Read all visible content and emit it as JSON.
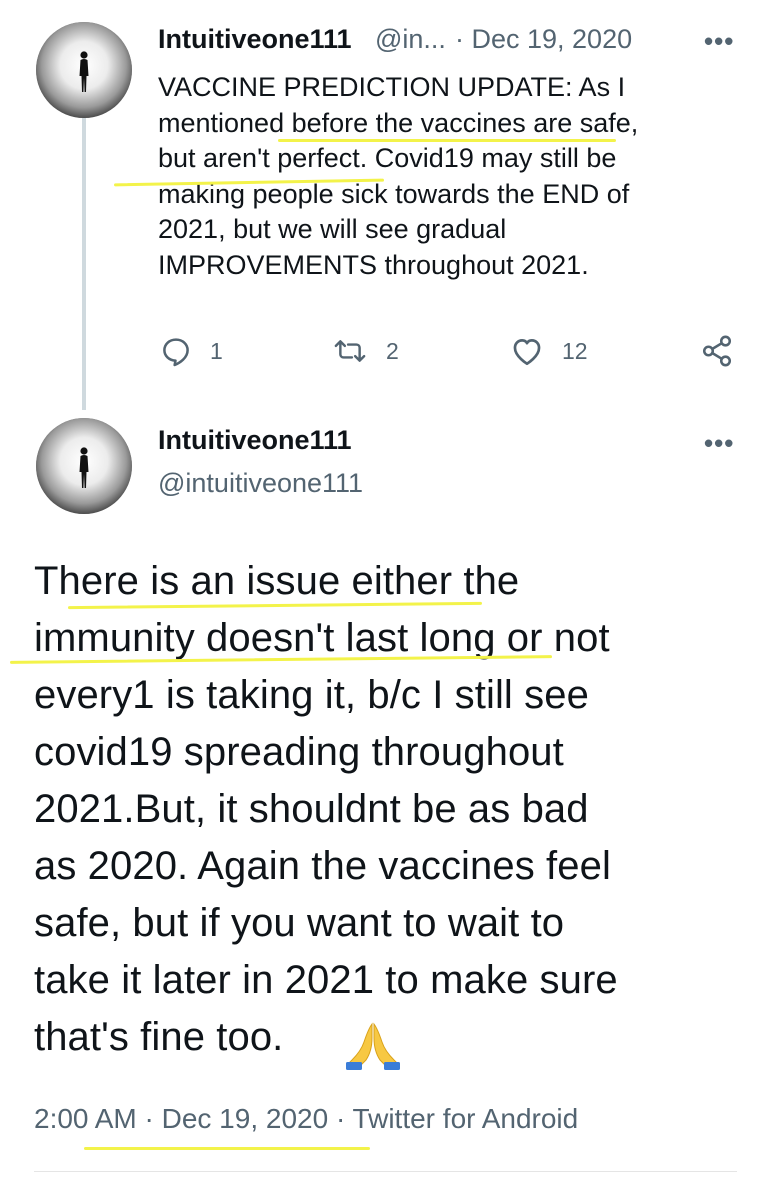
{
  "first_tweet": {
    "display_name": "Intuitiveone111",
    "handle_truncated": "@in...",
    "date": "· Dec 19, 2020",
    "more": "•••",
    "text": "VACCINE PREDICTION UPDATE: As I\nmentioned before the vaccines are safe,\nbut aren't perfect. Covid19 may still be\nmaking people sick towards the END of\n2021, but we will see gradual\nIMPROVEMENTS throughout 2021.",
    "actions": {
      "reply_count": "1",
      "retweet_count": "2",
      "like_count": "12"
    }
  },
  "main_tweet": {
    "display_name": "Intuitiveone111",
    "handle": "@intuitiveone111",
    "more": "•••",
    "text": "There is an issue either the\nimmunity doesn't last long or not\nevery1 is taking it, b/c I still see\ncovid19 spreading throughout\n2021.But, it shouldnt be as bad\nas 2020. Again the vaccines feel\nsafe, but if you want to wait to\ntake it later in 2021 to make sure\nthat's fine too.",
    "emoji": "folded-hands",
    "meta": "2:00 AM · Dec 19, 2020 · Twitter for Android"
  },
  "icons": [
    "reply-icon",
    "retweet-icon",
    "like-icon",
    "share-icon",
    "more-icon",
    "folded-hands-emoji"
  ],
  "colors": {
    "text": "#0f1419",
    "muted": "#536471",
    "thread_line": "#cfd9de",
    "highlight": "#f3f34a"
  }
}
